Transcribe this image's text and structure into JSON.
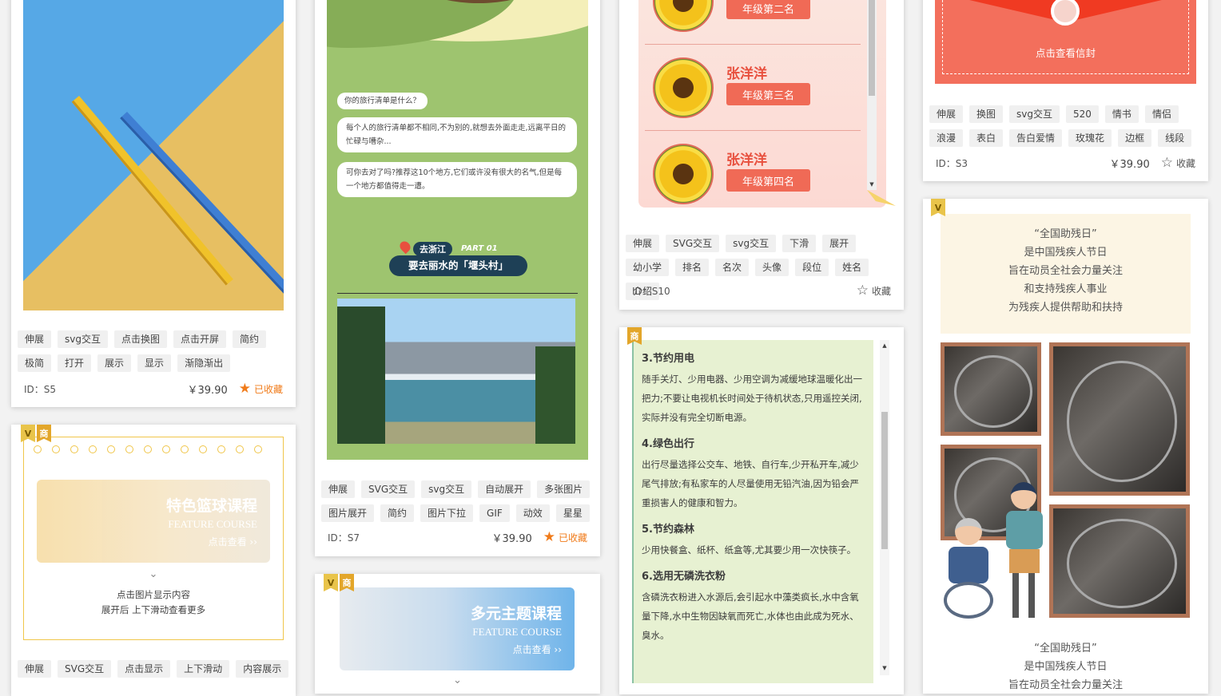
{
  "cards": {
    "s5": {
      "id_label": "ID：S5",
      "price": "￥39.90",
      "fav_label": "已收藏",
      "tags": [
        "伸展",
        "svg交互",
        "点击换图",
        "点击开屏",
        "简约",
        "极简",
        "打开",
        "展示",
        "显示",
        "渐隐渐出"
      ]
    },
    "course1": {
      "banner_title": "特色篮球课程",
      "banner_sub": "FEATURE COURSE",
      "banner_cta": "点击查看 ››",
      "hint1": "点击图片显示内容",
      "hint2": "展开后 上下滑动查看更多",
      "tags": [
        "伸展",
        "SVG交互",
        "点击显示",
        "上下滑动",
        "内容展示"
      ]
    },
    "s7": {
      "bubble_q": "你的旅行清单是什么？",
      "bubble_1": "每个人的旅行清单都不相同,不为别的,就想去外面走走,远离平日的忙碌与嘈杂...",
      "bubble_2": "可你去对了吗?推荐这10个地方,它们或许没有很大的名气,但是每一个地方都值得走一遭。",
      "loc_tag": "去浙江",
      "part_tag": "PART 01",
      "loc_title": "要去丽水的「堰头村」",
      "id_label": "ID：S7",
      "price": "￥39.90",
      "fav_label": "已收藏",
      "tags": [
        "伸展",
        "SVG交互",
        "svg交互",
        "自动展开",
        "多张图片",
        "图片展开",
        "简约",
        "图片下拉",
        "GIF",
        "动效",
        "星星"
      ]
    },
    "course2": {
      "banner_title": "多元主题课程",
      "banner_sub": "FEATURE COURSE",
      "banner_cta": "点击查看 ››"
    },
    "s10": {
      "ranks": [
        {
          "name": "",
          "grade": "年级第二名"
        },
        {
          "name": "张洋洋",
          "grade": "年级第三名"
        },
        {
          "name": "张洋洋",
          "grade": "年级第四名"
        }
      ],
      "id_label": "ID：S10",
      "fav_label": "收藏",
      "tags": [
        "伸展",
        "SVG交互",
        "svg交互",
        "下滑",
        "展开",
        "幼小学",
        "排名",
        "名次",
        "头像",
        "段位",
        "姓名",
        "介绍"
      ]
    },
    "tips": {
      "sections": [
        {
          "h": "3.节约用电",
          "p": "随手关灯、少用电器、少用空调为减缓地球温暖化出一把力;不要让电视机长时间处于待机状态,只用遥控关闭,实际并没有完全切断电源。"
        },
        {
          "h": "4.绿色出行",
          "p": "出行尽量选择公交车、地铁、自行车,少开私开车,减少尾气排放;有私家车的人尽量使用无铅汽油,因为铅会严重损害人的健康和智力。"
        },
        {
          "h": "5.节约森林",
          "p": "少用快餐盒、纸杯、纸盒等,尤其要少用一次快筷子。"
        },
        {
          "h": "6.选用无磷洗衣粉",
          "p": "含磷洗衣粉进入水源后,会引起水中藻类疯长,水中含氧量下降,水中生物因缺氧而死亡,水体也由此成为死水、臭水。"
        }
      ]
    },
    "s3": {
      "envelope_label": "点击查看信封",
      "id_label": "ID：S3",
      "price": "￥39.90",
      "fav_label": "收藏",
      "tags": [
        "伸展",
        "换图",
        "svg交互",
        "520",
        "情书",
        "情侣",
        "浪漫",
        "表白",
        "告白爱情",
        "玫瑰花",
        "边框",
        "线段"
      ]
    },
    "disability": {
      "quote_lines": [
        "“全国助残日”",
        "是中国残疾人节日",
        "旨在动员全社会力量关注",
        "和支持残疾人事业",
        "为残疾人提供帮助和扶持"
      ],
      "quote2_lines": [
        "“全国助残日”",
        "是中国残疾人节日",
        "旨在动员全社会力量关注"
      ]
    }
  },
  "badge": {
    "v": "V",
    "s": "商"
  },
  "colors": {
    "accent": "#f07b1a",
    "rank_red": "#f06a56",
    "green_bg": "#9ec46f"
  }
}
